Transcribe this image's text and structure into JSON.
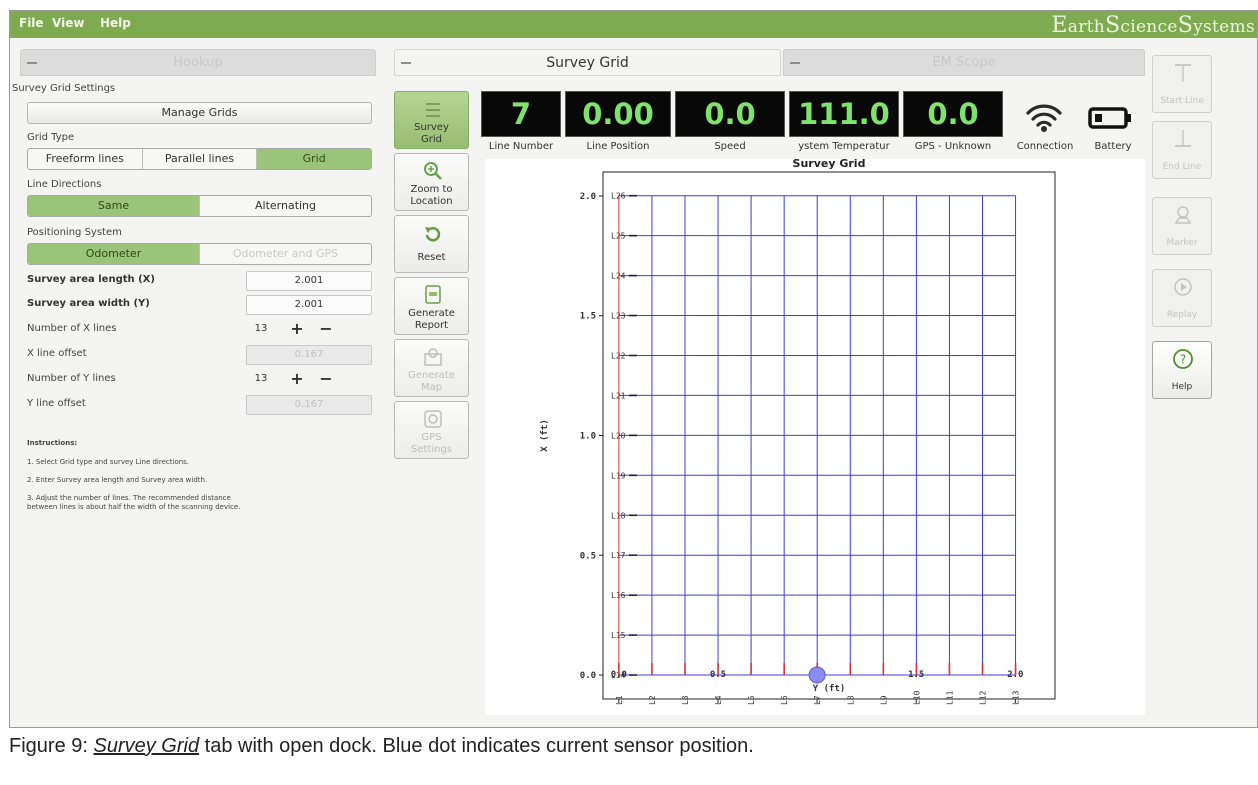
{
  "menu": {
    "file": "File",
    "view": "View",
    "help": "Help"
  },
  "brand": {
    "e": "E",
    "arth": "arth",
    "s1": "S",
    "cience": "cience",
    "s2": "S",
    "ystems": "ystems"
  },
  "tabs": [
    {
      "label": "Hookup"
    },
    {
      "label": "Survey Grid"
    },
    {
      "label": "EM Scope"
    }
  ],
  "settings": {
    "title": "Survey Grid Settings",
    "manage_grids": "Manage Grids",
    "grid_type_label": "Grid Type",
    "grid_type_options": [
      "Freeform lines",
      "Parallel lines",
      "Grid"
    ],
    "line_directions_label": "Line Directions",
    "line_directions_options": [
      "Same",
      "Alternating"
    ],
    "positioning_label": "Positioning System",
    "positioning_options": [
      "Odometer",
      "Odometer and GPS"
    ],
    "length_label": "Survey area length (X)",
    "length_value": "2.001",
    "width_label": "Survey area width (Y)",
    "width_value": "2.001",
    "x_lines_label": "Number of X lines",
    "x_lines_value": "13",
    "x_offset_label": "X line offset",
    "x_offset_value": "0.167",
    "y_lines_label": "Number of Y lines",
    "y_lines_value": "13",
    "y_offset_label": "Y line offset",
    "y_offset_value": "0.167",
    "plus": "+",
    "minus": "−"
  },
  "instructions": {
    "heading": "Instructions:",
    "step1": "1. Select Grid type and survey Line directions.",
    "step2": "2. Enter Survey area length and Survey area width.",
    "step3a": "3. Adjust the number of lines. The recommended distance",
    "step3b": "between lines is about half the width of the scanning device."
  },
  "tools": {
    "survey_grid": [
      "Survey",
      "Grid"
    ],
    "zoom": [
      "Zoom to",
      "Location"
    ],
    "reset": [
      "Reset"
    ],
    "report": [
      "Generate",
      "Report"
    ],
    "map": [
      "Generate",
      "Map"
    ],
    "gps": [
      "GPS",
      "Settings"
    ]
  },
  "readouts": {
    "line_number": {
      "value": "7",
      "label": "Line Number"
    },
    "line_position": {
      "value": "0.00",
      "label": "Line Position"
    },
    "speed": {
      "value": "0.0",
      "label": "Speed"
    },
    "temperature": {
      "value": "111.0",
      "label": "ystem Temperatur"
    },
    "gps": {
      "value": "0.0",
      "label": "GPS - Unknown"
    },
    "connection_label": "Connection",
    "battery_label": "Battery"
  },
  "right_buttons": {
    "start_line": "Start Line",
    "end_line": "End Line",
    "marker": "Marker",
    "replay": "Replay",
    "help": "Help"
  },
  "chart_data": {
    "type": "line",
    "title": "Survey Grid",
    "xlabel": "Y (ft)",
    "ylabel": "X (ft)",
    "xlim": [
      -0.08,
      2.2
    ],
    "ylim": [
      -0.1,
      2.1
    ],
    "x_ticks": [
      "0.0",
      "0.5",
      "1.0",
      "1.5",
      "2.0"
    ],
    "y_ticks": [
      "0.0",
      "0.5",
      "1.0",
      "1.5",
      "2.0"
    ],
    "vertical_lines": [
      "L1",
      "L2",
      "L3",
      "L4",
      "L5",
      "L6",
      "L7",
      "L8",
      "L9",
      "L10",
      "L11",
      "L12",
      "L13"
    ],
    "vertical_positions": [
      0.0,
      0.1668,
      0.3335,
      0.5003,
      0.667,
      0.8338,
      1.0005,
      1.1673,
      1.334,
      1.5008,
      1.6675,
      1.8343,
      2.001
    ],
    "horizontal_lines": [
      "L14",
      "L15",
      "L16",
      "L17",
      "L18",
      "L19",
      "L20",
      "L21",
      "L22",
      "L23",
      "L24",
      "L25",
      "L26"
    ],
    "horizontal_positions": [
      0.0,
      0.1668,
      0.3335,
      0.5003,
      0.667,
      0.8338,
      1.0005,
      1.1673,
      1.334,
      1.5008,
      1.6675,
      1.8343,
      2.001
    ],
    "current_position": {
      "y": 1.0,
      "x": 0.0
    },
    "grid_color": "#3b3be6",
    "current_line_color": "#e03030",
    "marker_color": "#8a8cf0"
  },
  "caption": {
    "prefix": "Figure 9: ",
    "tab_name": "Survey Grid",
    "suffix": " tab with open dock.  Blue dot indicates current sensor position."
  }
}
